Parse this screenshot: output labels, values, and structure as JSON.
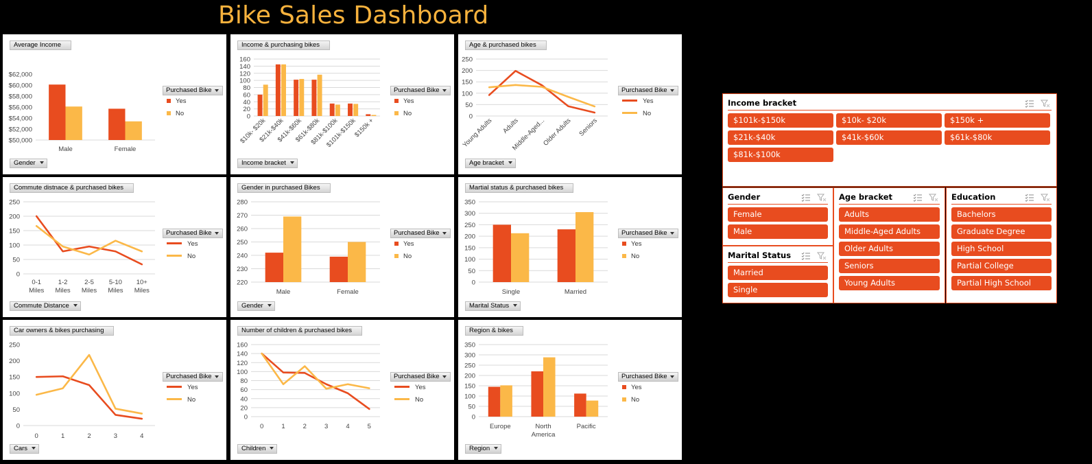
{
  "title": "Bike Sales Dashboard",
  "colors": {
    "yes": "#e84c1f",
    "no": "#fbb848",
    "accent": "#f7b23d",
    "slicer": "#e84c1f"
  },
  "legend": {
    "header": "Purchased Bike",
    "yes": "Yes",
    "no": "No"
  },
  "charts": [
    {
      "id": "income",
      "tag": "Average  Income",
      "field": "Gender",
      "chart_data": {
        "type": "bar",
        "categories": [
          "Male",
          "Female"
        ],
        "series": [
          {
            "name": "Yes",
            "values": [
              60100,
              55700
            ]
          },
          {
            "name": "No",
            "values": [
              56100,
              53400
            ]
          }
        ],
        "ylim": [
          50000,
          62000
        ],
        "yticks": [
          "$50,000",
          "$52,000",
          "$54,000",
          "$56,000",
          "$58,000",
          "$60,000",
          "$62,000"
        ],
        "legend": "right",
        "grid": false
      }
    },
    {
      "id": "incomebracket",
      "tag": "Income & purchasing  bikes",
      "field": "Income bracket",
      "chart_data": {
        "type": "bar",
        "categories": [
          "$10k- $20k",
          "$21k-$40k",
          "$41k-$60k",
          "$61k-$80k",
          "$81k-$100k",
          "$101k-$150k",
          "$150k +"
        ],
        "series": [
          {
            "name": "Yes",
            "values": [
              60,
              145,
              102,
              102,
              35,
              35,
              5
            ]
          },
          {
            "name": "No",
            "values": [
              88,
              145,
              104,
              116,
              32,
              34,
              3
            ]
          }
        ],
        "ylim": [
          0,
          160
        ],
        "yticks": [
          "0",
          "20",
          "40",
          "60",
          "80",
          "100",
          "120",
          "140",
          "160"
        ],
        "legend": "right",
        "grid": true
      }
    },
    {
      "id": "age",
      "tag": "Age & purchased  bikes",
      "field": "Age bracket",
      "chart_data": {
        "type": "line",
        "categories": [
          "Young Adults",
          "Adults",
          "Middle-Aged...",
          "Older Adults",
          "Seniors"
        ],
        "series": [
          {
            "name": "Yes",
            "values": [
              92,
              198,
              135,
              43,
              15
            ]
          },
          {
            "name": "No",
            "values": [
              126,
              136,
              128,
              84,
              42
            ]
          }
        ],
        "ylim": [
          0,
          250
        ],
        "yticks": [
          "0",
          "50",
          "100",
          "150",
          "200",
          "250"
        ],
        "legend": "right",
        "grid": true
      }
    },
    {
      "id": "commute",
      "tag": "Commute distnace & purchased  bikes",
      "field": "Commute Distance",
      "chart_data": {
        "type": "line",
        "categories": [
          "0-1 Miles",
          "1-2 Miles",
          "2-5 Miles",
          "5-10 Miles",
          "10+ Miles"
        ],
        "series": [
          {
            "name": "Yes",
            "values": [
              200,
              78,
              95,
              78,
              33
            ]
          },
          {
            "name": "No",
            "values": [
              166,
              95,
              67,
              115,
              78
            ]
          }
        ],
        "ylim": [
          0,
          250
        ],
        "yticks": [
          "0",
          "50",
          "100",
          "150",
          "200",
          "250"
        ],
        "legend": "right",
        "grid": true
      }
    },
    {
      "id": "gender",
      "tag": "Gender in purchased  Bikes",
      "field": "Gender",
      "chart_data": {
        "type": "bar",
        "categories": [
          "Male",
          "Female"
        ],
        "series": [
          {
            "name": "Yes",
            "values": [
              242,
              239
            ]
          },
          {
            "name": "No",
            "values": [
              269,
              250
            ]
          }
        ],
        "ylim": [
          220,
          280
        ],
        "yticks": [
          "220",
          "230",
          "240",
          "250",
          "260",
          "270",
          "280"
        ],
        "legend": "right",
        "grid": true
      }
    },
    {
      "id": "marital",
      "tag": "Martial status & purchased  bikes",
      "field": "Marital Status",
      "chart_data": {
        "type": "bar",
        "categories": [
          "Single",
          "Married"
        ],
        "series": [
          {
            "name": "Yes",
            "values": [
              250,
              230
            ]
          },
          {
            "name": "No",
            "values": [
              213,
              305
            ]
          }
        ],
        "ylim": [
          0,
          350
        ],
        "yticks": [
          "0",
          "50",
          "100",
          "150",
          "200",
          "250",
          "300",
          "350"
        ],
        "legend": "right",
        "grid": true
      }
    },
    {
      "id": "cars",
      "tag": "Car owners & bikes purchasing",
      "field": "Cars",
      "chart_data": {
        "type": "line",
        "categories": [
          "0",
          "1",
          "2",
          "3",
          "4"
        ],
        "series": [
          {
            "name": "Yes",
            "values": [
              150,
              152,
              125,
              33,
              21
            ]
          },
          {
            "name": "No",
            "values": [
              95,
              115,
              218,
              52,
              37
            ]
          }
        ],
        "ylim": [
          0,
          250
        ],
        "yticks": [
          "0",
          "50",
          "100",
          "150",
          "200",
          "250"
        ],
        "legend": "right",
        "grid": false
      }
    },
    {
      "id": "children",
      "tag": "Number of children  & purchased  bikes",
      "field": "Children",
      "chart_data": {
        "type": "line",
        "categories": [
          "0",
          "1",
          "2",
          "3",
          "4",
          "5"
        ],
        "series": [
          {
            "name": "Yes",
            "values": [
              140,
              98,
              97,
              72,
              52,
              17
            ]
          },
          {
            "name": "No",
            "values": [
              140,
              72,
              112,
              62,
              72,
              63
            ]
          }
        ],
        "ylim": [
          0,
          160
        ],
        "yticks": [
          "0",
          "20",
          "40",
          "60",
          "80",
          "100",
          "120",
          "140",
          "160"
        ],
        "legend": "right",
        "grid": true
      }
    },
    {
      "id": "region",
      "tag": "Region & bikes",
      "field": "Region",
      "chart_data": {
        "type": "bar",
        "categories": [
          "Europe",
          "North America",
          "Pacific"
        ],
        "series": [
          {
            "name": "Yes",
            "values": [
              145,
              220,
              112
            ]
          },
          {
            "name": "No",
            "values": [
              152,
              288,
              78
            ]
          }
        ],
        "ylim": [
          0,
          350
        ],
        "yticks": [
          "0",
          "50",
          "100",
          "150",
          "200",
          "250",
          "300",
          "350"
        ],
        "legend": "right",
        "grid": true
      }
    }
  ],
  "slicers": {
    "income": {
      "title": "Income bracket",
      "items": [
        "$101k-$150k",
        "$10k- $20k",
        "$150k +",
        "$21k-$40k",
        "$41k-$60k",
        "$61k-$80k",
        "$81k-$100k"
      ]
    },
    "gender": {
      "title": "Gender",
      "items": [
        "Female",
        "Male"
      ]
    },
    "marital": {
      "title": "Marital Status",
      "items": [
        "Married",
        "Single"
      ]
    },
    "age": {
      "title": "Age bracket",
      "items": [
        "Adults",
        "Middle-Aged Adults",
        "Older Adults",
        "Seniors",
        "Young Adults"
      ]
    },
    "education": {
      "title": "Education",
      "items": [
        "Bachelors",
        "Graduate Degree",
        "High School",
        "Partial College",
        "Partial High School"
      ]
    }
  }
}
